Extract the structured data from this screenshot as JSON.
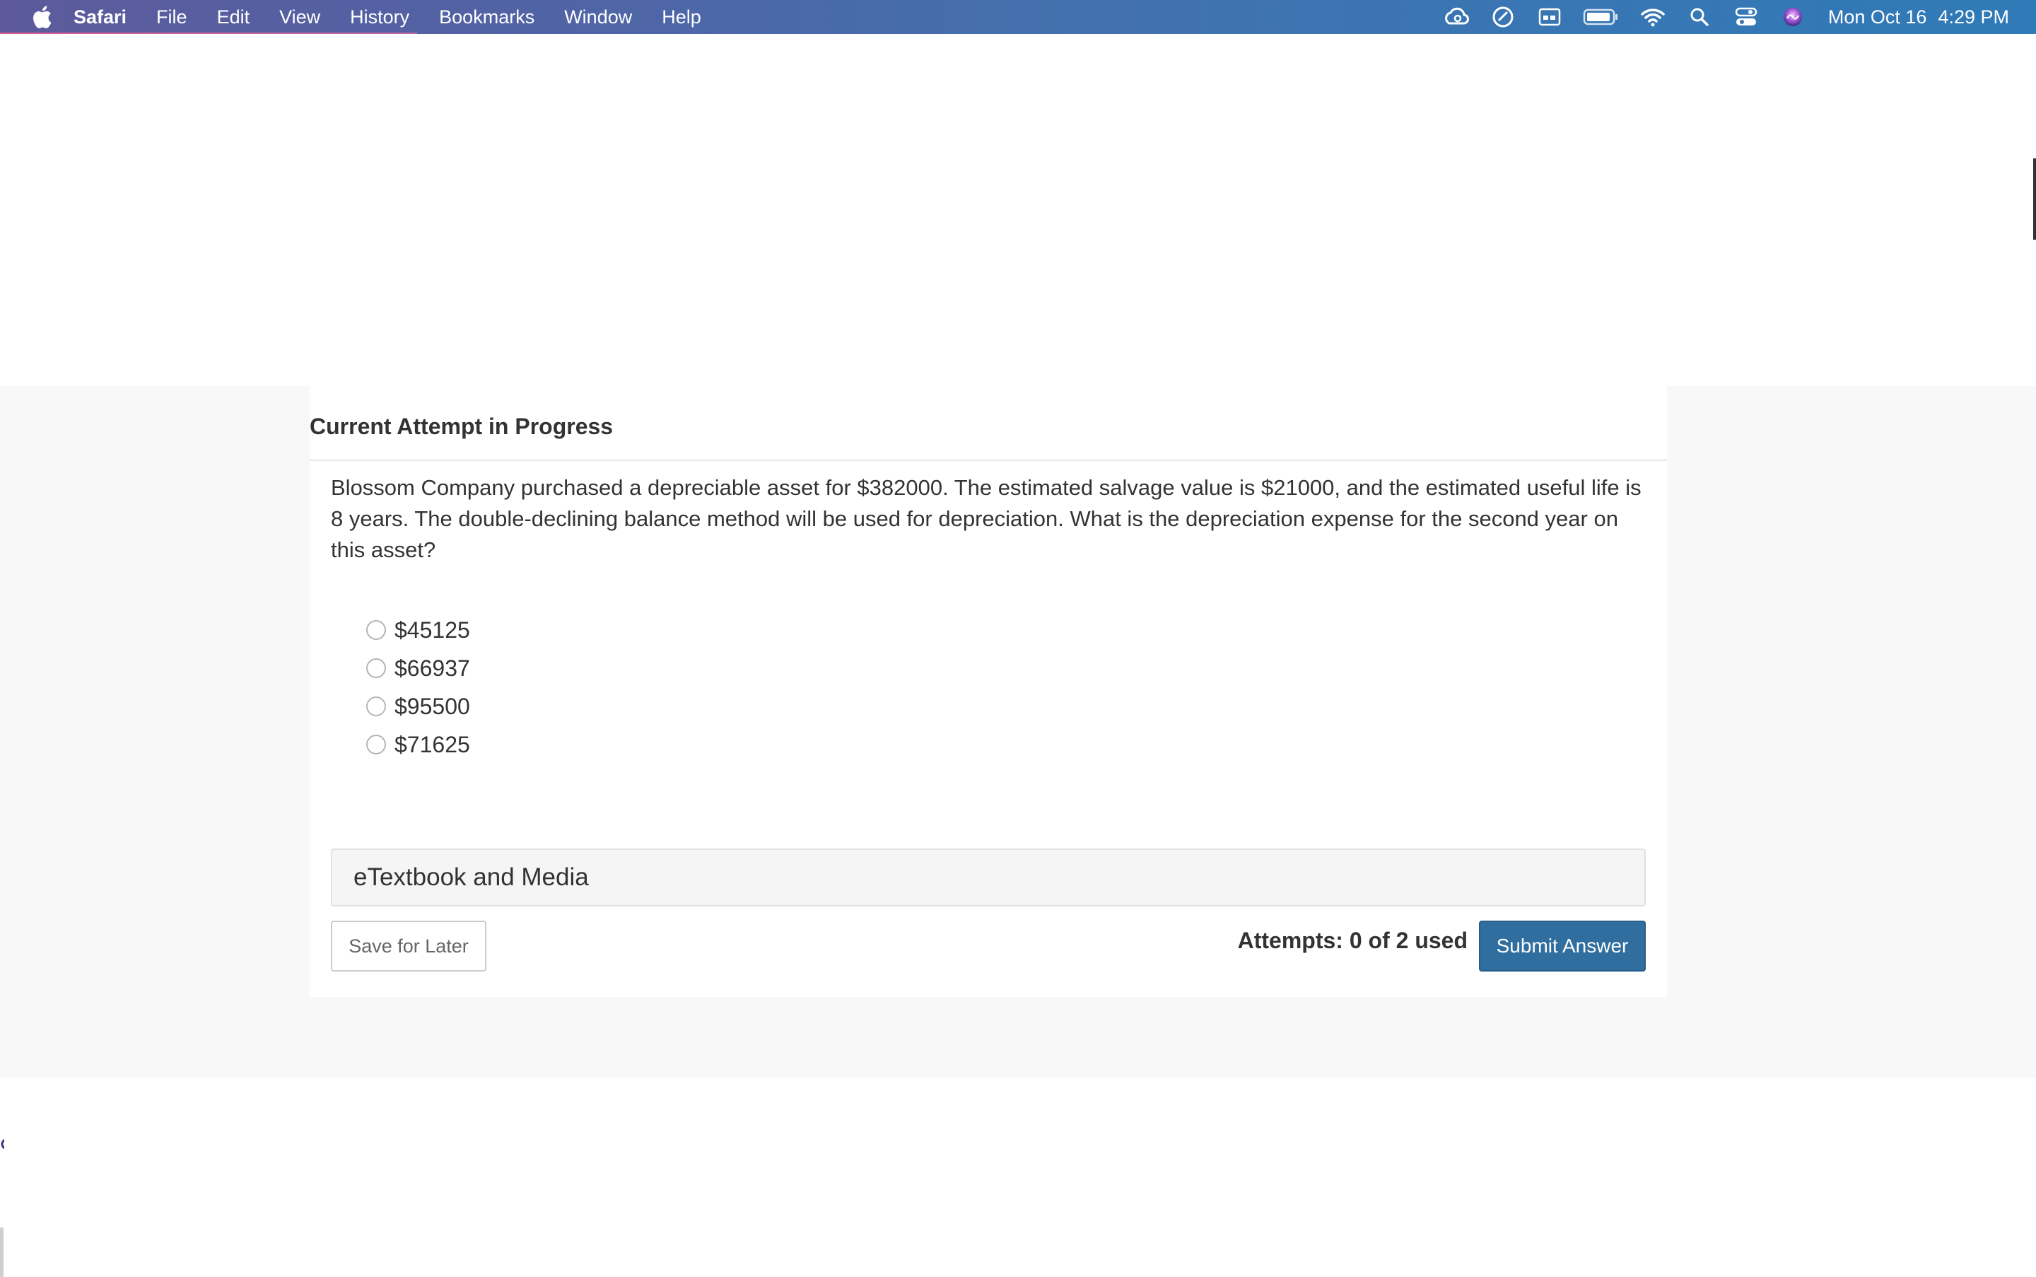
{
  "menubar": {
    "app_name": "Safari",
    "menus": [
      "File",
      "Edit",
      "View",
      "History",
      "Bookmarks",
      "Window",
      "Help"
    ],
    "clock_date": "Mon Oct 16",
    "clock_time": "4:29 PM",
    "status_icons": [
      "creative-cloud-icon",
      "sync-icon",
      "display-icon",
      "battery-icon",
      "wifi-icon",
      "spotlight-search-icon",
      "control-center-icon",
      "siri-icon"
    ]
  },
  "card": {
    "title": "Current Attempt in Progress",
    "question": "Blossom Company purchased a depreciable asset for $382000. The estimated salvage value is $21000, and the estimated useful life is 8 years. The double-declining balance method will be used for depreciation. What is the depreciation expense for the second year on this asset?",
    "options": [
      "$45125",
      "$66937",
      "$95500",
      "$71625"
    ],
    "etextbook_label": "eTextbook and Media",
    "save_label": "Save for Later",
    "attempts_text": "Attempts: 0 of 2 used",
    "submit_label": "Submit Answer"
  },
  "colors": {
    "submit_bg": "#2f6e9f",
    "page_band": "#f8f8f8"
  }
}
